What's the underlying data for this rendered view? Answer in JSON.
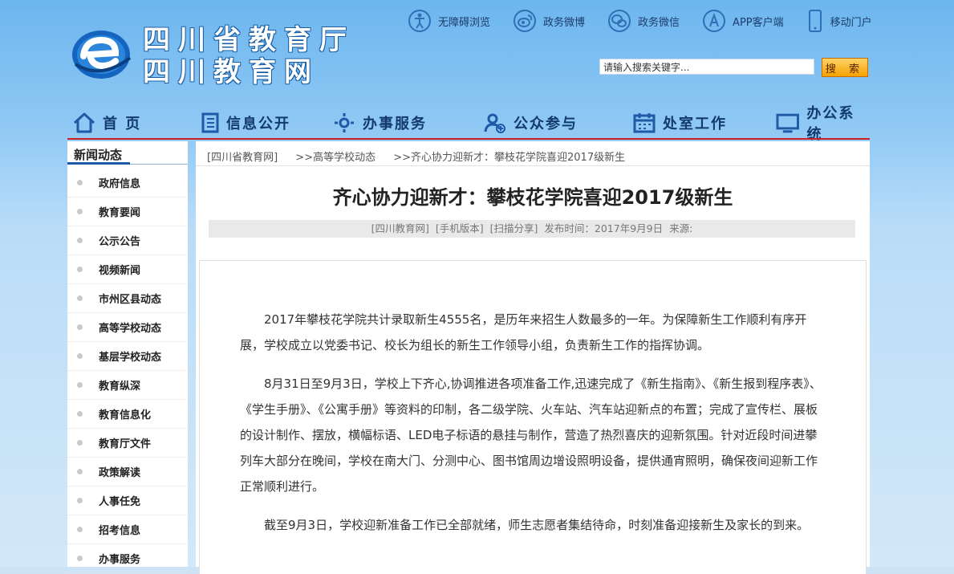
{
  "header": {
    "title_line1": "四川省教育厅",
    "title_line2": "四川教育网",
    "top_links": [
      {
        "label": "无障碍浏览",
        "icon": "accessibility-icon"
      },
      {
        "label": "政务微博",
        "icon": "weibo-icon"
      },
      {
        "label": "政务微信",
        "icon": "wechat-icon"
      },
      {
        "label": "APP客户端",
        "icon": "app-store-icon"
      },
      {
        "label": "移动门户",
        "icon": "mobile-phone-icon"
      }
    ],
    "search": {
      "placeholder": "请输入搜索关键字...",
      "button_label": "搜 索"
    }
  },
  "nav": [
    {
      "label": "首 页",
      "icon": "home-icon"
    },
    {
      "label": "信息公开",
      "icon": "document-icon"
    },
    {
      "label": "办事服务",
      "icon": "service-icon"
    },
    {
      "label": "公众参与",
      "icon": "user-add-icon"
    },
    {
      "label": "处室工作",
      "icon": "calendar-icon"
    },
    {
      "label": "办公系统",
      "icon": "monitor-icon"
    }
  ],
  "sidebar": {
    "heading": "新闻动态",
    "items": [
      "政府信息",
      "教育要闻",
      "公示公告",
      "视频新闻",
      "市州区县动态",
      "高等学校动态",
      "基层学校动态",
      "教育纵深",
      "教育信息化",
      "教育厅文件",
      "政策解读",
      "人事任免",
      "招考信息",
      "办事服务"
    ]
  },
  "breadcrumb": [
    "[四川省教育网]",
    ">>高等学校动态",
    ">>齐心协力迎新才：攀枝花学院喜迎2017级新生"
  ],
  "article": {
    "title": "齐心协力迎新才：攀枝花学院喜迎2017级新生",
    "meta": {
      "site": "[四川教育网]",
      "mobile": "[手机版本]",
      "share": "[扫描分享]",
      "date": "发布时间：2017年9月9日",
      "source": "来源:"
    },
    "paragraphs": [
      "2017年攀枝花学院共计录取新生4555名，是历年来招生人数最多的一年。为保障新生工作顺利有序开展，学校成立以党委书记、校长为组长的新生工作领导小组，负责新生工作的指挥协调。",
      "8月31日至9月3日，学校上下齐心,协调推进各项准备工作,迅速完成了《新生指南》、《新生报到程序表》、《学生手册》、《公寓手册》等资料的印制，各二级学院、火车站、汽车站迎新点的布置；完成了宣传栏、展板的设计制作、摆放，横幅标语、LED电子标语的悬挂与制作，营造了热烈喜庆的迎新氛围。针对近段时间进攀列车大部分在晚间，学校在南大门、分测中心、图书馆周边增设照明设备，提供通宵照明，确保夜间迎新工作正常顺利进行。",
      "截至9月3日，学校迎新准备工作已全部就绪，师生志愿者集结待命，时刻准备迎接新生及家长的到来。"
    ]
  },
  "colors": {
    "nav_text": "#123a6e",
    "nav_underline": "#cc1f1f",
    "search_button": "#f5a100"
  }
}
